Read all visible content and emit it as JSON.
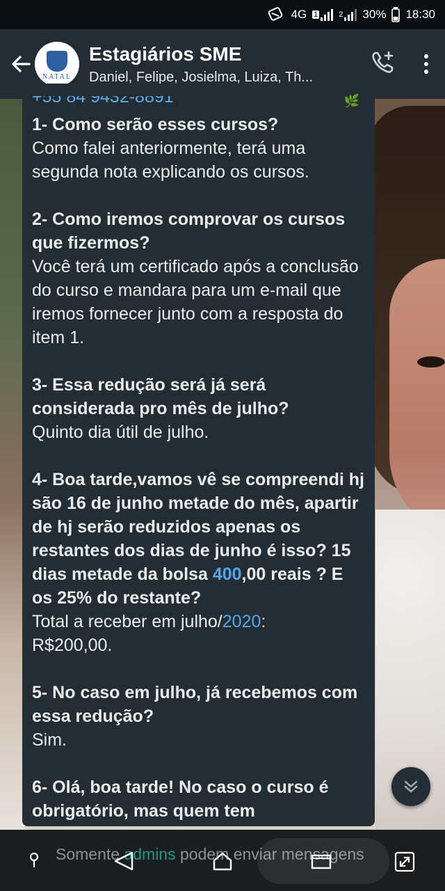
{
  "status_bar": {
    "network": "4G",
    "sim1_badge": "1",
    "sim2_badge": "2",
    "battery": "30%",
    "time": "18:30"
  },
  "header": {
    "title": "Estagiários SME",
    "subtitle": "Daniel, Felipe, Josielma, Luiza, Th...",
    "avatar_text": "NATAL",
    "icons": [
      "back-arrow-icon",
      "add-call-icon",
      "more-vert-icon"
    ]
  },
  "message": {
    "partial_top": "+55 84 9432-8891",
    "items": [
      {
        "question": "1- Como serão esses cursos?",
        "answer": "Como falei anteriormente, terá uma segunda nota explicando os cursos."
      },
      {
        "question": "2- Como iremos comprovar os cursos que fizermos?",
        "answer": "Você terá um certificado após a conclusão do curso e mandara para um e-mail que iremos fornecer junto com a resposta do item 1."
      },
      {
        "question": "3- Essa redução será já será considerada pro mês de julho?",
        "answer": "Quinto dia útil de julho."
      },
      {
        "question_part1": "4- Boa tarde,vamos vê  se compreendi hj são 16 de junho metade do mês, apartir  de hj serão reduzidos apenas os restantes dos dias de junho é isso? 15 dias metade da bolsa ",
        "question_link": "400",
        "question_part2": ",00 reais ? E os 25% do restante?",
        "answer_part1": "Total a receber em julho/",
        "answer_link": "2020",
        "answer_part2": ":",
        "answer_line2": "R$200,00."
      },
      {
        "question": "5- No caso em julho, já recebemos com essa redução?",
        "answer": "Sim."
      },
      {
        "question": "6- Olá, boa tarde! No caso o curso é obrigatório, mas quem tem"
      }
    ]
  },
  "footer": {
    "notice_part1": "Somente ",
    "notice_link": "admins",
    "notice_part2": " podem enviar mensagens"
  },
  "colors": {
    "bubble": "#232d33",
    "appbar": "#232d33",
    "link": "#53a6ea",
    "admins": "#1f9c84"
  }
}
